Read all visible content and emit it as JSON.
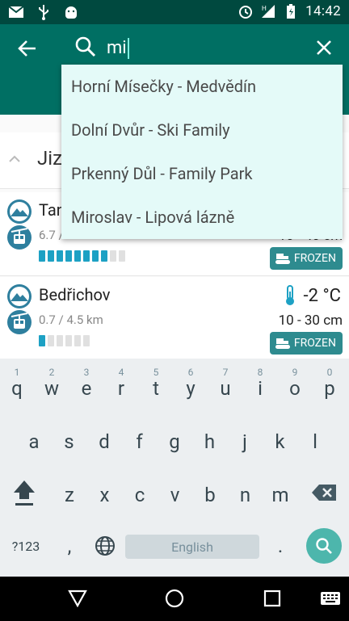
{
  "status_bar": {
    "time": "14:42",
    "network": "H",
    "icons": [
      "gmail-icon",
      "usb-icon",
      "android-debug-icon",
      "alarm-icon",
      "signal-icon",
      "battery-charging-icon"
    ]
  },
  "search": {
    "value": "mi",
    "placeholder": ""
  },
  "suggestions": [
    "Horní Mísečky - Medvědín",
    "Dolní Dvůr - Ski Family",
    "Prkenný Důl - Family Park",
    "Miroslav - Lipová lázně"
  ],
  "section": {
    "title": "Jizerské hory"
  },
  "resorts": [
    {
      "name": "Tanvaldský Špičák",
      "km": "6.7 / 8.2 km",
      "progress_fraction": 0.82,
      "segments_on": 8,
      "segments_total": 10,
      "temp": "",
      "snow": "10 - 40 cm",
      "status": "FROZEN"
    },
    {
      "name": "Bedřichov",
      "km": "0.7 / 4.5 km",
      "progress_fraction": 0.16,
      "segments_on": 1,
      "segments_total": 6,
      "temp": "-2 °C",
      "snow": "10 - 30 cm",
      "status": "FROZEN"
    }
  ],
  "keyboard": {
    "row1": [
      "q",
      "w",
      "e",
      "r",
      "t",
      "y",
      "u",
      "i",
      "o",
      "p"
    ],
    "row1_hints": [
      "1",
      "2",
      "3",
      "4",
      "5",
      "6",
      "7",
      "8",
      "9",
      "0"
    ],
    "row2": [
      "a",
      "s",
      "d",
      "f",
      "g",
      "h",
      "j",
      "k",
      "l"
    ],
    "row3": [
      "z",
      "x",
      "c",
      "v",
      "b",
      "n",
      "m"
    ],
    "symbols_label": "?123",
    "comma": ",",
    "period": ".",
    "space_label": "English"
  },
  "colors": {
    "primary": "#006f63",
    "primary_dark": "#00493f",
    "accent": "#4db6ac",
    "progress": "#1da1c4",
    "badge": "#2e8b8f"
  }
}
